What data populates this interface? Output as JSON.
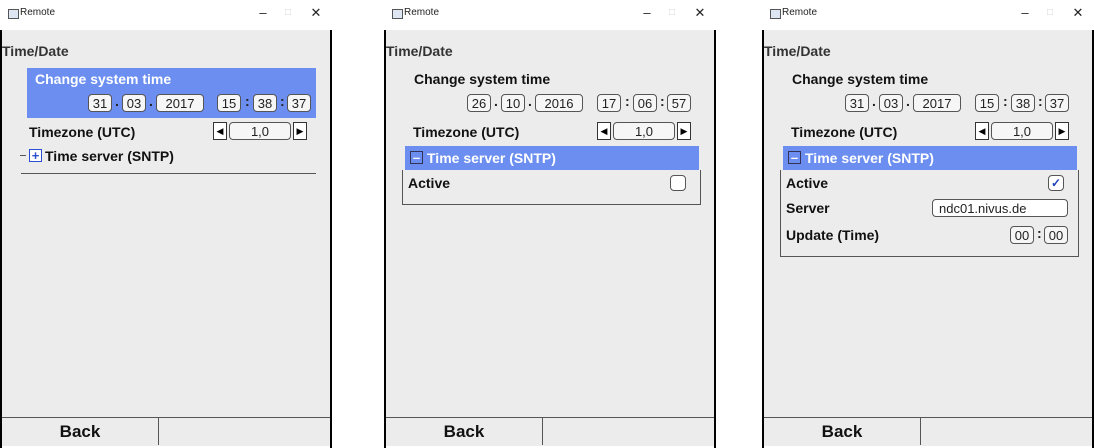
{
  "window": {
    "title": "Remote",
    "minimize": "–",
    "maximize": "□",
    "close": "✕"
  },
  "screen_title": "Time/Date",
  "labels": {
    "change_system_time": "Change system time",
    "timezone": "Timezone (UTC)",
    "time_server": "Time server (SNTP)",
    "active": "Active",
    "server": "Server",
    "update_time": "Update (Time)",
    "back": "Back"
  },
  "separators": {
    "date": ".",
    "time": ":"
  },
  "panels": [
    {
      "day": "31",
      "month": "03",
      "year": "2017",
      "hour": "15",
      "minute": "38",
      "second": "37",
      "timezone": "1,0",
      "sntp_expanded": false,
      "sntp_toggle": "+"
    },
    {
      "day": "26",
      "month": "10",
      "year": "2016",
      "hour": "17",
      "minute": "06",
      "second": "57",
      "timezone": "1,0",
      "sntp_expanded": true,
      "sntp_toggle": "–",
      "active_checked": false,
      "active_mark": ""
    },
    {
      "day": "31",
      "month": "03",
      "year": "2017",
      "hour": "15",
      "minute": "38",
      "second": "37",
      "timezone": "1,0",
      "sntp_expanded": true,
      "sntp_toggle": "–",
      "active_checked": true,
      "active_mark": "✓",
      "server": "ndc01.nivus.de",
      "update_hour": "00",
      "update_minute": "00"
    }
  ],
  "icons": {
    "left": "◀",
    "right": "▶",
    "window": "window-icon"
  }
}
